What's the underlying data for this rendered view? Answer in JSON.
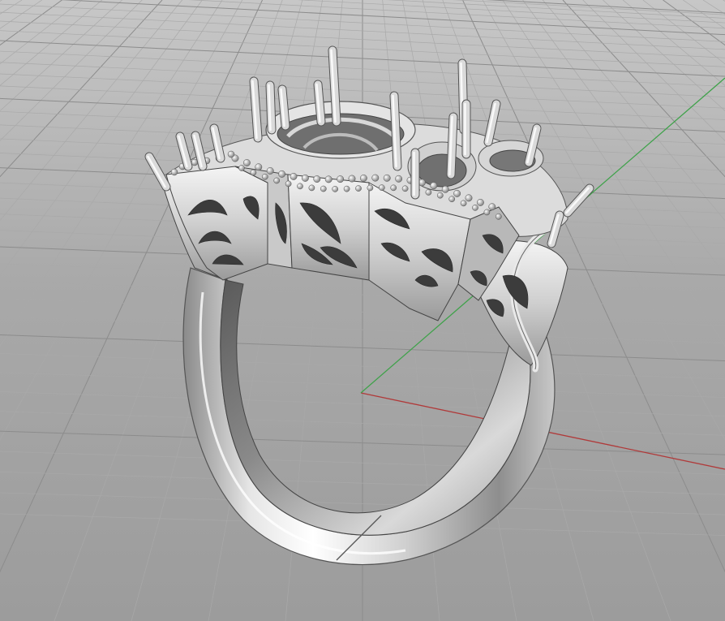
{
  "viewport": {
    "view": "Perspective",
    "background_color": "#9e9e9e",
    "grid_minor_color": "#a9a9a9",
    "grid_major_color": "#8c8c8c",
    "x_axis_color": "#b03a3a",
    "y_axis_color": "#3fa24a",
    "model": {
      "name": "ring",
      "metal_light": "#f2f2f2",
      "metal_mid": "#bdbdbd",
      "metal_dark": "#4a4a4a",
      "prong_count": 16
    }
  }
}
